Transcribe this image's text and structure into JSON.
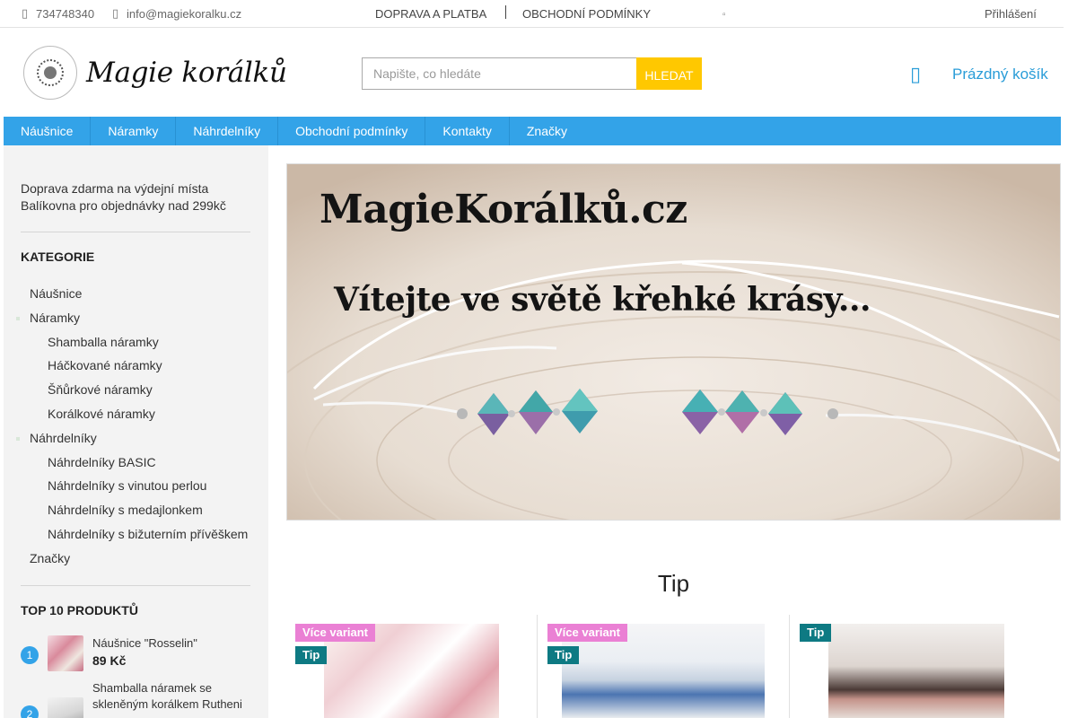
{
  "topbar": {
    "phone": "734748340",
    "email": "info@magiekoralku.cz",
    "links": [
      "DOPRAVA A PLATBA",
      "OBCHODNÍ PODMÍNKY"
    ],
    "login": "Přihlášení",
    "icons": {
      "phone": "phone-icon",
      "email": "envelope-icon"
    }
  },
  "header": {
    "logo_text": "Magie korálků",
    "search_placeholder": "Napište, co hledáte",
    "search_button": "HLEDAT",
    "cart_text": "Prázdný košík",
    "accent_color": "#33a3e8",
    "button_color": "#ffc800"
  },
  "nav": {
    "items": [
      "Náušnice",
      "Náramky",
      "Náhrdelníky",
      "Obchodní podmínky",
      "Kontakty",
      "Značky"
    ]
  },
  "sidebar": {
    "promo": "Doprava zdarma na výdejní místa Balíkovna pro objednávky nad 299kč",
    "categories_title": "KATEGORIE",
    "categories": [
      {
        "label": "Náušnice",
        "level": 0,
        "bullet": false
      },
      {
        "label": "Náramky",
        "level": 0,
        "bullet": true
      },
      {
        "label": "Shamballa náramky",
        "level": 1,
        "bullet": false
      },
      {
        "label": "Háčkované náramky",
        "level": 1,
        "bullet": false
      },
      {
        "label": "Šňůrkové náramky",
        "level": 1,
        "bullet": false
      },
      {
        "label": "Korálkové náramky",
        "level": 1,
        "bullet": false
      },
      {
        "label": "Náhrdelníky",
        "level": 0,
        "bullet": true
      },
      {
        "label": "Náhrdelníky BASIC",
        "level": 1,
        "bullet": false
      },
      {
        "label": "Náhrdelníky s vinutou perlou",
        "level": 1,
        "bullet": false
      },
      {
        "label": "Náhrdelníky s medajlonkem",
        "level": 1,
        "bullet": false
      },
      {
        "label": "Náhrdelníky s bižuterním přívěškem",
        "level": 1,
        "bullet": false
      },
      {
        "label": "Značky",
        "level": 0,
        "bullet": false
      }
    ],
    "top10_title": "TOP 10 PRODUKTŮ",
    "top10": [
      {
        "rank": "1",
        "name": "Náušnice \"Rosselin\"",
        "price": "89 Kč"
      },
      {
        "rank": "2",
        "name": "Shamballa náramek se skleněným korálkem Rutheni",
        "price": ""
      }
    ]
  },
  "banner": {
    "title": "MagieKorálků.cz",
    "subtitle": "Vítejte ve světě křehké krásy..."
  },
  "tip_section": {
    "title": "Tip",
    "products": [
      {
        "badges": [
          "Více variant",
          "Tip"
        ]
      },
      {
        "badges": [
          "Více variant",
          "Tip"
        ]
      },
      {
        "badges": [
          "Tip"
        ]
      }
    ]
  }
}
